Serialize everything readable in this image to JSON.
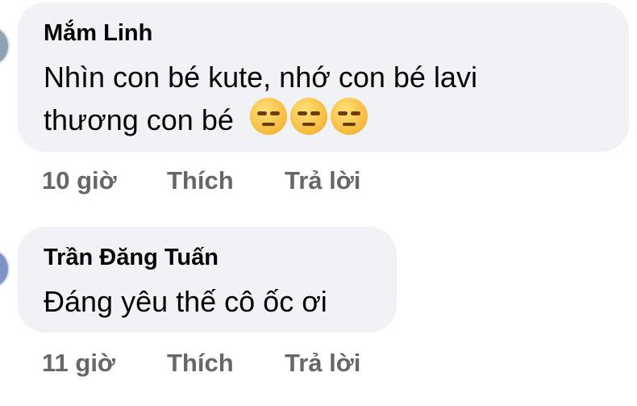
{
  "comments": [
    {
      "author": "Mắm Linh",
      "lines": [
        "Nhìn con bé kute, nhớ con bé lavi",
        "thương con bé"
      ],
      "emojis": [
        "unamused-face-icon",
        "unamused-face-icon",
        "unamused-face-icon"
      ],
      "time": "10 giờ",
      "like_label": "Thích",
      "reply_label": "Trả lời"
    },
    {
      "author": "Trần Đăng Tuấn",
      "lines": [
        "Đáng yêu thế cô ốc ơi"
      ],
      "time": "11 giờ",
      "like_label": "Thích",
      "reply_label": "Trả lời"
    }
  ],
  "colors": {
    "bubble_bg": "#f0f2f5",
    "meta_text": "#65676b",
    "name_text": "#050505"
  }
}
